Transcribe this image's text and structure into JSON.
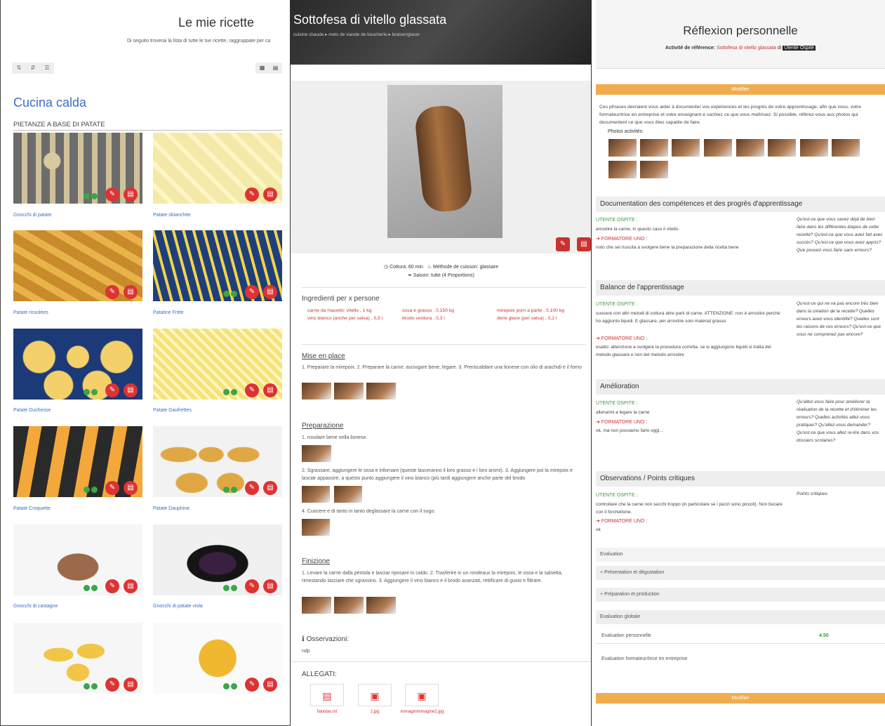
{
  "panel1": {
    "title": "Le mie ricette",
    "subtitle": "Di seguito troverai la lista di tutte le tue ricette, raggruppate per ca",
    "category": "Cucina calda",
    "subcategory": "PIETANZE A BASE DI PATATE",
    "recipes": [
      {
        "name": "Gnocchi di patate"
      },
      {
        "name": "Patate sbianchite"
      },
      {
        "name": "Patate rissolées"
      },
      {
        "name": "Patatine Fritte"
      },
      {
        "name": "Patate Duchesse"
      },
      {
        "name": "Patate Gaufrettes"
      },
      {
        "name": "Patate Croquette"
      },
      {
        "name": "Patate Dauphine"
      },
      {
        "name": "Gnocchi di castagne"
      },
      {
        "name": "Gnocchi di patate viola"
      },
      {
        "name": ""
      },
      {
        "name": ""
      }
    ]
  },
  "panel2": {
    "title": "Sottofesa di vitello glassata",
    "breadcrumb": "cuisine chaude ▸ mets de viande de boucherie ▸ braiser/glacer",
    "cottura": "Cottura: 60 min",
    "metodo": "Méthode de cuisson: glassare",
    "saison": "Saison: tutte (4 Proportions)",
    "ingredients_title": "Ingredienti per x persone",
    "ingredients": [
      "carne da macello: vitello , 1 kg",
      "ossa e grasso , 0,150 kg",
      "mirepoix porri a parte , 0,100 kg",
      "vino bianco (anche per salsa) , 0,5 l",
      "brodo verdura , 0,3 l",
      "demi glace (per salsa) , 0,2 l"
    ],
    "mise_title": "Mise en place",
    "mise_text": "1. Preparare la mirepoix. 2. Preparare la carne: asciugare bene, legare. 3. Preriscaldare una lionese con olio di arachidi e il forno",
    "prep_title": "Preparazione",
    "prep_text1": "1. rosolare bene nella lionese.",
    "prep_text2": "2. Sgrassare, aggiungere le ossa e infornare (queste lasceranno il loro grasso e i loro aromi). 3. Aggiungere poi la mirepoix e lasciar appassire, a questo punto aggiungere il vino bianco (più tardi aggiungere anche parte del brodo",
    "prep_text3": "4. Cuocere e di tanto in tanto deglassare la carne con il sugo.",
    "fin_title": "Finizione",
    "fin_text": "1. Levare la carne dalla pentola e lasciar riposare in caldo. 2. Trasferire in un rondeaux la mirepoix, le ossa e la salsetta, rimestando lasciare che sgrassino. 3. Aggiungere il vino bianco e il brodo avanzati, rettificare di gusto e filtrare.",
    "oss_title": "Osservazioni:",
    "oss_text": "ndp",
    "allegati_title": "ALLEGATI:",
    "attachments": [
      "fiatiotas.txt",
      "2.jpg",
      "immaginimmagine2.jpg"
    ]
  },
  "panel3": {
    "title": "Réflexion personnelle",
    "ref_label": "Activité de référence:",
    "ref_link": "Sottofesa di vitello glassata",
    "ref_di": "di",
    "ref_user": "Utente Ospite",
    "modify": "Modifier",
    "intro": "Ces phrases devraient vous aider à documenter vos expériences et les progrès de votre apprentissage, afin que vous, votre formateur/trice en entreprise et votre enseignant·e sachiez ce que vous maîtrisez. Si possible, référez-vous aux photos qui documentent ce que vous êtes capable de faire.",
    "photos_label": "Photos activités:",
    "utente": "UTENTE OSPITE :",
    "formatore": "➜ FORMATORE UNO :",
    "sections": [
      {
        "title": "Documentation des compétences et des progrès d'apprentissage",
        "user_text": "arrostire la carne, in questo caso il vitello.",
        "trainer_text": "noto che sei riuscita a svolgere bene la preparazione della ricetta bene",
        "questions": "Qu'est-ce que vous savez déjà de bien faire dans les différentes étapes de cette recette? Qu'est-ce que vous avez fait avec succès? Qu'est-ce que vous avez appris? Que pouvez-vous faire sans erreurs?"
      },
      {
        "title": "Balance de l'apprentissage",
        "user_text": "cuocere con altri metodi di cottura altre parti di carne. ATTENZIONE: non è arrostire perché ho aggiunto liquidi. E glassare, per arrostire solo material grasso",
        "trainer_text": "esatto: attenzione a svolgere la procedura corretta. se si aggiungono liquidi si tratta del metodo glassare e non del metodo arrostire",
        "questions": "Qu'est-ce qui ne va pas encore très bien dans la création de la recette? Quelles erreurs avez-vous identifié? Quelles sont les raisons de ces erreurs? Qu'est-ce que vous ne comprenez pas encore?"
      },
      {
        "title": "Amélioration",
        "user_text": "allenarmi a legare la carne",
        "trainer_text": "ok, ma non possiamo farlo oggi...",
        "questions": "Qu'allez-vous faire pour améliorer la réalisation de la recette et d'éliminer les erreurs? Quelles activités allez-vous pratiquer? Qu'allez-vous demander? Qu'est-ce que vous allez re-lire dans vos dossiers scolaires?"
      },
      {
        "title": "Observations / Points critiques",
        "user_text": "controllare che la carne non secchi troppo (in particolare se i pezzi sono piccoli). Non bucare con il forchettone.",
        "trainer_text": "ok",
        "questions": "Points critiques"
      }
    ],
    "evaluation_label": "Evaluation",
    "eval_sections": [
      "+ Présentation et dégustation",
      "+ Préparation et production"
    ],
    "eval_global": "Evaluation globale",
    "eval_personal": "Evaluation personnelle",
    "eval_personal_value": "4.50",
    "eval_trainer": "Evaluation formateur/trice en entreprise"
  }
}
